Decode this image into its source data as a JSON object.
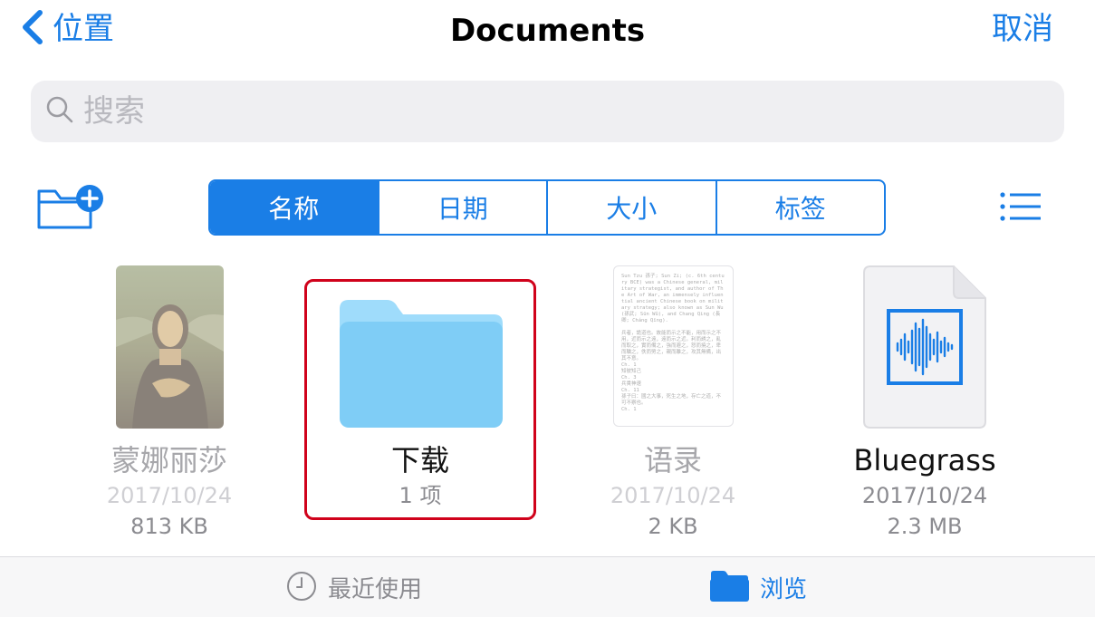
{
  "header": {
    "back_label": "位置",
    "title": "Documents",
    "cancel_label": "取消"
  },
  "search": {
    "placeholder": "搜索",
    "value": ""
  },
  "sort": {
    "options": [
      "名称",
      "日期",
      "大小",
      "标签"
    ],
    "selected": "名称"
  },
  "items": [
    {
      "name": "蒙娜丽莎",
      "date": "2017/10/24",
      "size": "813 KB",
      "kind": "image",
      "enabled": false
    },
    {
      "name": "下载",
      "count": "1 项",
      "kind": "folder",
      "enabled": true,
      "selected": true
    },
    {
      "name": "语录",
      "date": "2017/10/24",
      "size": "2 KB",
      "kind": "text",
      "enabled": false
    },
    {
      "name": "Bluegrass",
      "date": "2017/10/24",
      "size": "2.3 MB",
      "kind": "audio",
      "enabled": true
    }
  ],
  "doc_preview": "Sun Tzu 孫子; Sun Zi; (c. 6th century BCE) was a Chinese general, military strategist, and author of The Art of War, an immensely influential ancient Chinese book on military strategy; also known as Sun Wu (孫武; Sūn Wǔ), and Chang Qing (長卿; Cháng Qīng).\n\n兵者，詭道也。故能而示之不能，用而示之不用，近而示之遠，遠而示之近。利而誘之，亂而取之，實而備之，強而避之，怒而撓之，卑而驕之，佚而勞之，親而離之，攻其無備，出其不意。\nCh. 1\n知彼知己\nCh. 3\n兵貴神速\nCh. 11\n孫子曰：國之大事，死生之地，存亡之道，不可不察也。\nCh. 1",
  "tabbar": {
    "recent_label": "最近使用",
    "browse_label": "浏览",
    "active": "browse"
  },
  "colors": {
    "accent": "#1a7ee6",
    "folder": "#7fcdf6",
    "selection_border": "#d0021b"
  }
}
